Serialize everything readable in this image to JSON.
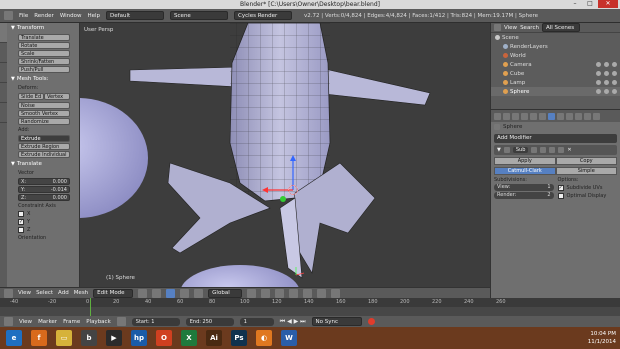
{
  "window": {
    "title": "Blender* [C:\\Users\\Owner\\Desktop\\bear.blend]",
    "minimize": "–",
    "maximize": "□",
    "close": "✕"
  },
  "main_header": {
    "menus": [
      "File",
      "Render",
      "Window",
      "Help"
    ],
    "layout": "Default",
    "scene": "Scene",
    "engine": "Cycles Render",
    "stats": "v2.72 | Verts:0/4,824 | Edges:4/4,824 | Faces:1/412 | Tris:824 | Mem:19.17M | Sphere"
  },
  "tool_shelf": {
    "transform_header": "Transform",
    "transform_buttons": [
      "Translate",
      "Rotate",
      "Scale",
      "Shrink/Fatten",
      "Push/Pull"
    ],
    "mesh_tools_header": "Mesh Tools:",
    "deform_label": "Deform:",
    "slide_row": [
      "Slide Ed",
      "Vertex"
    ],
    "deform_buttons": [
      "Noise",
      "Smooth Vertex",
      "Randomize"
    ],
    "add_label": "Add:",
    "extrude_select": "Extrude",
    "extrude_buttons": [
      "Extrude Region",
      "Extrude Individual"
    ],
    "translate_header": "Translate",
    "vector_label": "Vector",
    "vector": [
      {
        "axis": "X:",
        "value": "0.000"
      },
      {
        "axis": "Y:",
        "value": "-0.014"
      },
      {
        "axis": "Z:",
        "value": "0.000"
      }
    ],
    "constraint_label": "Constraint Axis",
    "constraints": [
      {
        "label": "X",
        "checked": ""
      },
      {
        "label": "Y",
        "checked": "✓"
      },
      {
        "label": "Z",
        "checked": ""
      }
    ],
    "orientation_label": "Orientation"
  },
  "viewport": {
    "view_label": "User Persp",
    "object_label": "(1) Sphere"
  },
  "viewport_header": {
    "menus": [
      "View",
      "Select",
      "Add",
      "Mesh"
    ],
    "mode": "Edit Mode",
    "orientation": "Global"
  },
  "timeline": {
    "ticks": [
      "-40",
      "-20",
      "0",
      "20",
      "40",
      "60",
      "80",
      "100",
      "120",
      "140",
      "160",
      "180",
      "200",
      "220",
      "240",
      "260"
    ],
    "menus": [
      "View",
      "Marker",
      "Frame",
      "Playback"
    ],
    "start_label": "Start:",
    "start_value": "1",
    "end_label": "End:",
    "end_value": "250",
    "current_frame": "1",
    "sync": "No Sync"
  },
  "outliner": {
    "menus": [
      "View",
      "Search"
    ],
    "filter": "All Scenes",
    "items": [
      {
        "name": "Scene",
        "color": "#c9c9c9"
      },
      {
        "name": "RenderLayers",
        "color": "#9fb0c8"
      },
      {
        "name": "World",
        "color": "#c9643c"
      },
      {
        "name": "Camera",
        "color": "#e0a050"
      },
      {
        "name": "Cube",
        "color": "#e0a050"
      },
      {
        "name": "Lamp",
        "color": "#e0a050"
      },
      {
        "name": "Sphere",
        "color": "#e0a050"
      }
    ]
  },
  "properties": {
    "object_name": "Sphere",
    "add_modifier": "Add Modifier",
    "modifier_name": "Sub",
    "apply": "Apply",
    "copy": "Copy",
    "catmull": "Catmull-Clark",
    "simple": "Simple",
    "subdivisions_label": "Subdivisions:",
    "view_label": "View:",
    "view_value": "1",
    "render_label": "Render:",
    "render_value": "2",
    "options_label": "Options:",
    "subdivide_uvs": "Subdivide UVs",
    "optimal_display": "Optimal Display"
  },
  "taskbar": {
    "icons": [
      {
        "name": "ie-icon",
        "glyph": "e",
        "color": "#1f6fc1"
      },
      {
        "name": "firefox-icon",
        "glyph": "f",
        "color": "#d96a1c"
      },
      {
        "name": "explorer-icon",
        "glyph": "▭",
        "color": "#d6b23a"
      },
      {
        "name": "blender-icon",
        "glyph": "b",
        "color": "#444"
      },
      {
        "name": "media-icon",
        "glyph": "▶",
        "color": "#2b2b2b"
      },
      {
        "name": "hp-icon",
        "glyph": "hp",
        "color": "#1a5ca8"
      },
      {
        "name": "office-icon",
        "glyph": "O",
        "color": "#d04020"
      },
      {
        "name": "excel-icon",
        "glyph": "X",
        "color": "#1f7a3c"
      },
      {
        "name": "illustrator-icon",
        "glyph": "Ai",
        "color": "#4a2a12"
      },
      {
        "name": "photoshop-icon",
        "glyph": "Ps",
        "color": "#10324e"
      },
      {
        "name": "orange-blender-icon",
        "glyph": "◐",
        "color": "#e07820"
      },
      {
        "name": "word-icon",
        "glyph": "W",
        "color": "#2a5ea8"
      }
    ],
    "time": "10:04 PM",
    "date": "11/1/2014"
  }
}
